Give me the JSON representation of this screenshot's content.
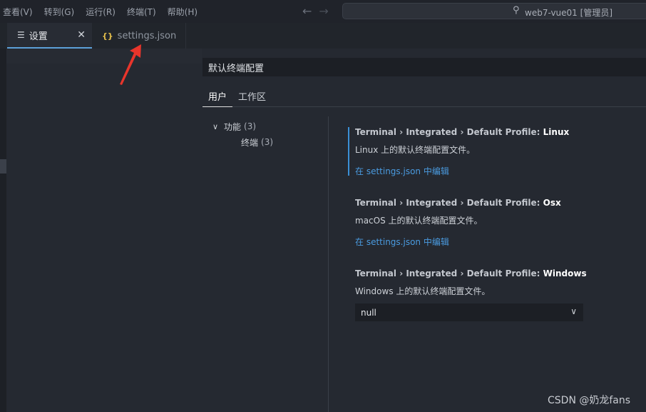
{
  "menu": {
    "items": [
      "查看(V)",
      "转到(G)",
      "运行(R)",
      "终端(T)",
      "帮助(H)"
    ]
  },
  "nav": {
    "back": "←",
    "forward": "→"
  },
  "titlebar": {
    "search_text": "web7-vue01 [管理员]"
  },
  "tabs": [
    {
      "label": "设置",
      "icon": "settings-editor-icon",
      "close": "✕"
    },
    {
      "label": "settings.json",
      "icon": "json-braces-icon"
    }
  ],
  "settings": {
    "search_value": "默认终端配置",
    "scopes": [
      "用户",
      "工作区"
    ],
    "toc": {
      "parent": {
        "label": "功能",
        "count": "(3)"
      },
      "child": {
        "label": "终端",
        "count": "(3)"
      }
    },
    "items": [
      {
        "prefix": "Terminal › Integrated › Default Profile: ",
        "key": "Linux",
        "description": "Linux 上的默认终端配置文件。",
        "link": "在 settings.json 中编辑"
      },
      {
        "prefix": "Terminal › Integrated › Default Profile: ",
        "key": "Osx",
        "description": "macOS 上的默认终端配置文件。",
        "link": "在 settings.json 中编辑"
      },
      {
        "prefix": "Terminal › Integrated › Default Profile: ",
        "key": "Windows",
        "description": "Windows 上的默认终端配置文件。",
        "select_value": "null"
      }
    ]
  },
  "annotation": {
    "arrow_color": "#e8352b"
  },
  "watermark": "CSDN @奶龙fans",
  "colors": {
    "accent": "#5ca0d8",
    "link": "#4a9be0",
    "background": "#252931"
  }
}
